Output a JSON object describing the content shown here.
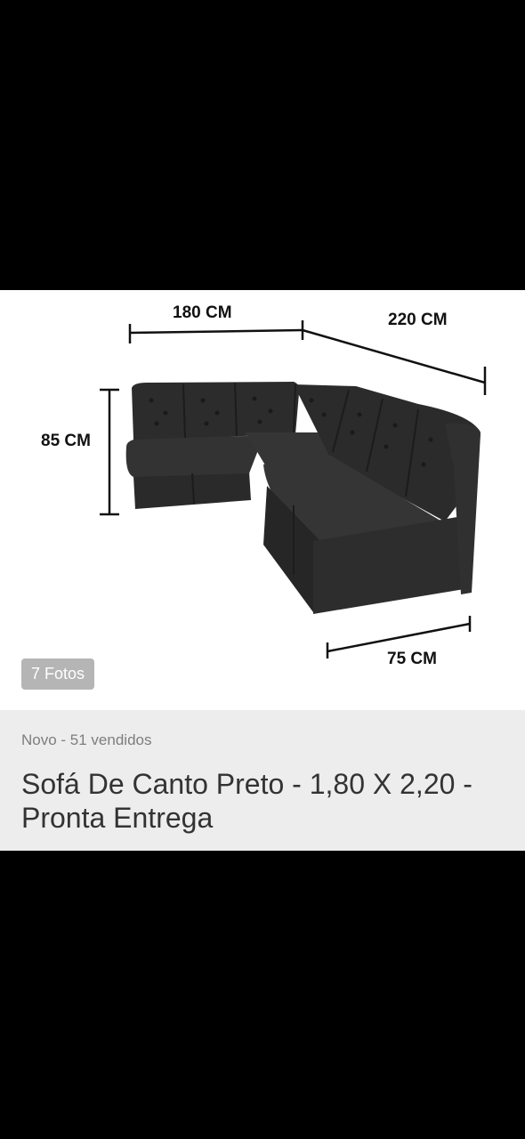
{
  "gallery": {
    "photo_counter": "7 Fotos",
    "image_subject": "sofa-icon",
    "dimensions": {
      "width_front": "180 CM",
      "width_side": "220 CM",
      "height": "85 CM",
      "depth": "75 CM"
    }
  },
  "product": {
    "condition_sales": "Novo - 51 vendidos",
    "title": "Sofá De Canto Preto - 1,80 X 2,20 - Pronta Entrega"
  },
  "colors": {
    "background_dark": "#000000",
    "info_panel": "#ededed",
    "title_text": "#333333",
    "subtitle_text": "#7d7d7d",
    "sofa": "#2f2f2f"
  }
}
